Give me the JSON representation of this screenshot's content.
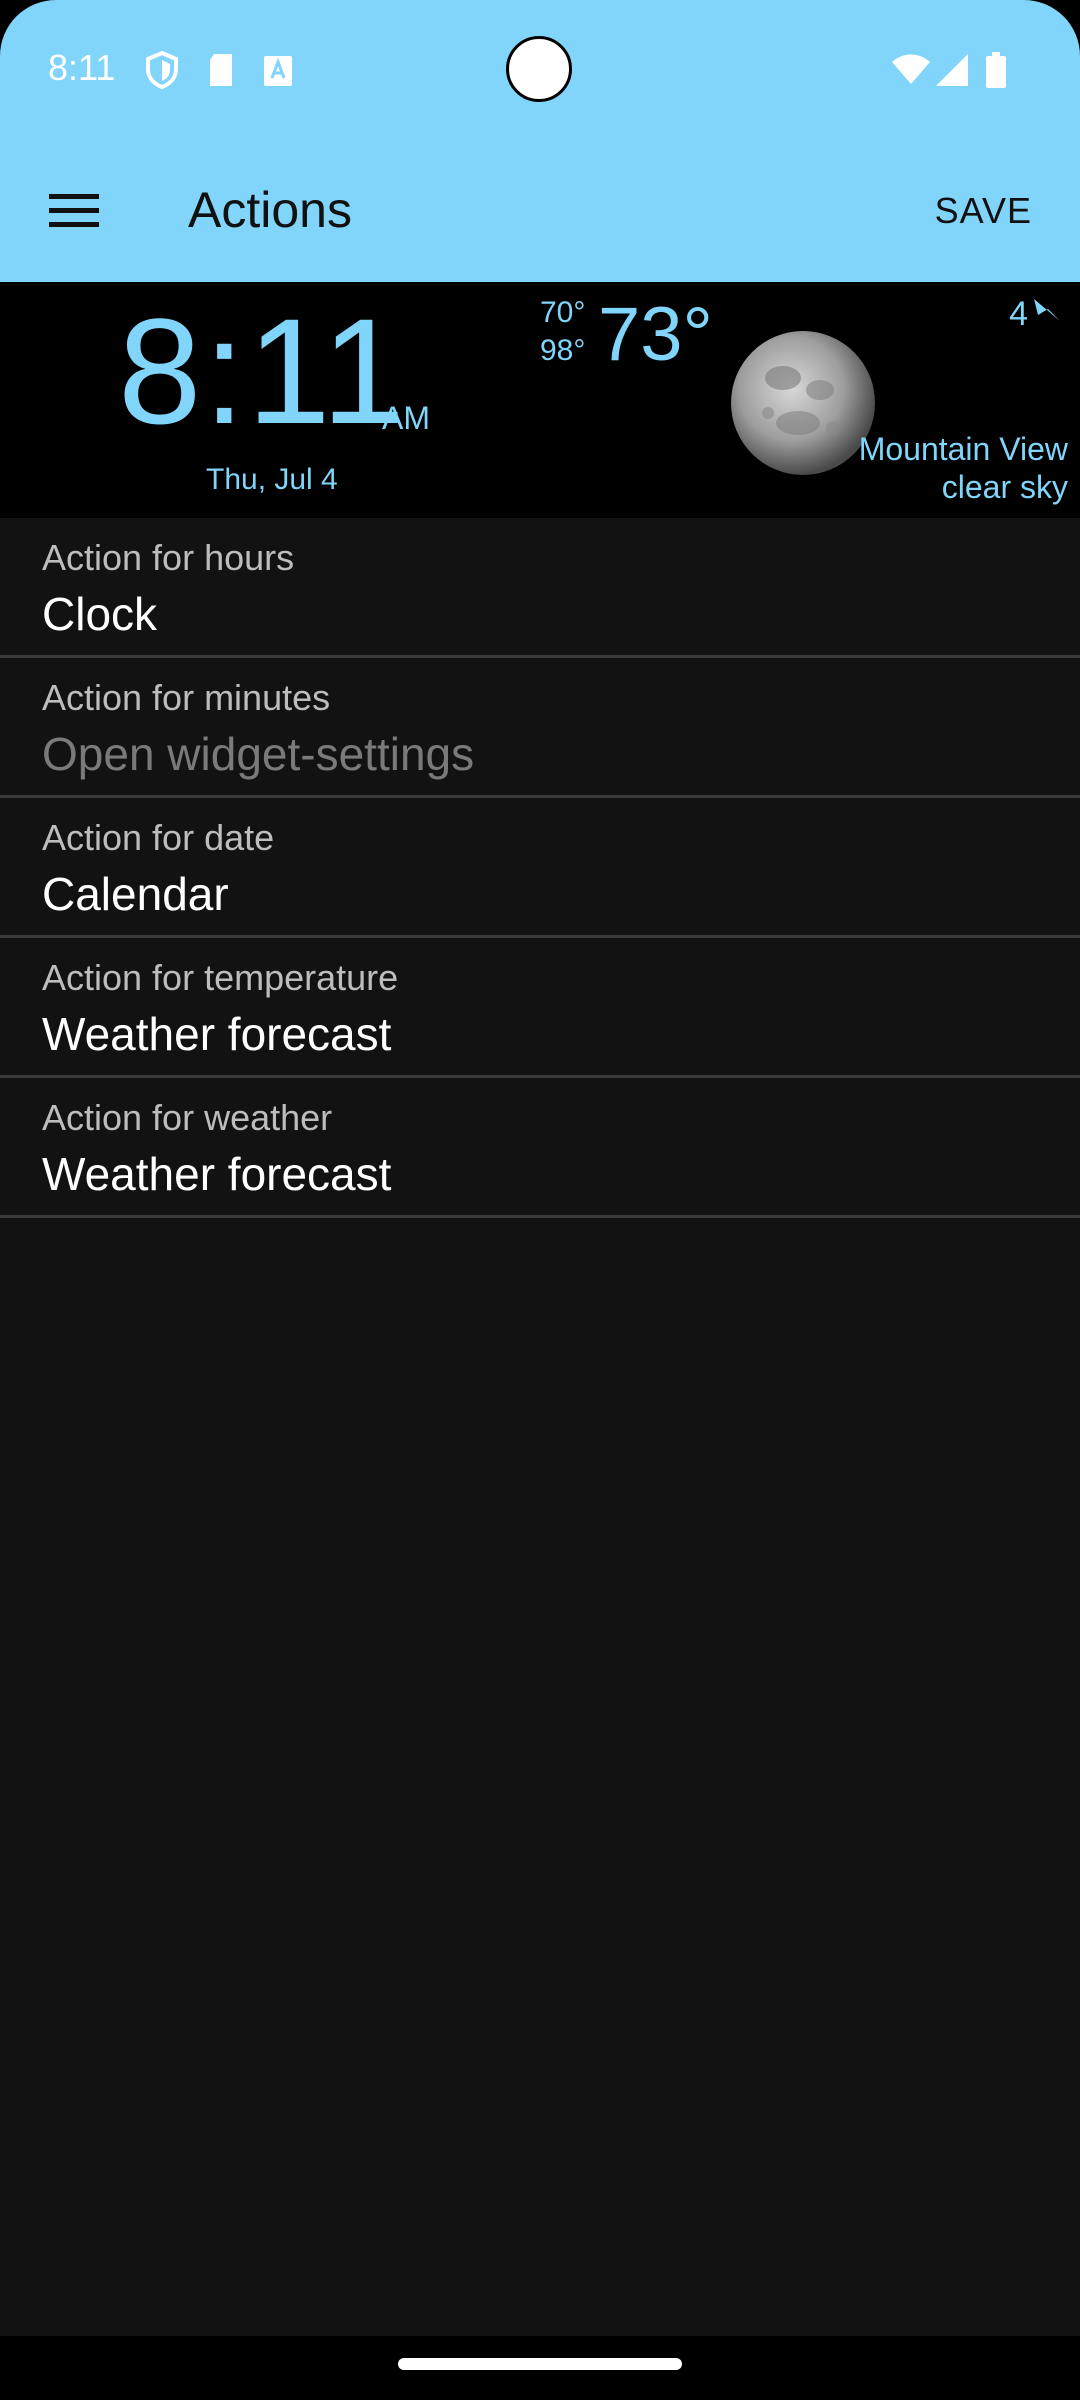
{
  "status_bar": {
    "time": "8:11",
    "icons": [
      "shield-icon",
      "sd-card-icon",
      "font-a-icon",
      "wifi-icon",
      "cell-signal-icon",
      "battery-icon"
    ]
  },
  "app_bar": {
    "title": "Actions",
    "save_label": "SAVE",
    "menu_icon": "hamburger-menu-icon"
  },
  "widget": {
    "time": "8:11",
    "ampm": "AM",
    "date": "Thu, Jul 4",
    "temp_low": "70°",
    "temp_high": "98°",
    "temp_current": "73°",
    "wind_speed": "4",
    "location": "Mountain View",
    "condition": "clear sky",
    "accent_color": "#81d4fa"
  },
  "actions": [
    {
      "title": "Action for hours",
      "value": "Clock",
      "enabled": true
    },
    {
      "title": "Action for minutes",
      "value": "Open widget-settings",
      "enabled": false
    },
    {
      "title": "Action for date",
      "value": "Calendar",
      "enabled": true
    },
    {
      "title": "Action for temperature",
      "value": "Weather forecast",
      "enabled": true
    },
    {
      "title": "Action for weather",
      "value": "Weather forecast",
      "enabled": true
    }
  ],
  "colors": {
    "app_bar": "#81d4fa",
    "background": "#121212",
    "widget_background": "#000000"
  }
}
